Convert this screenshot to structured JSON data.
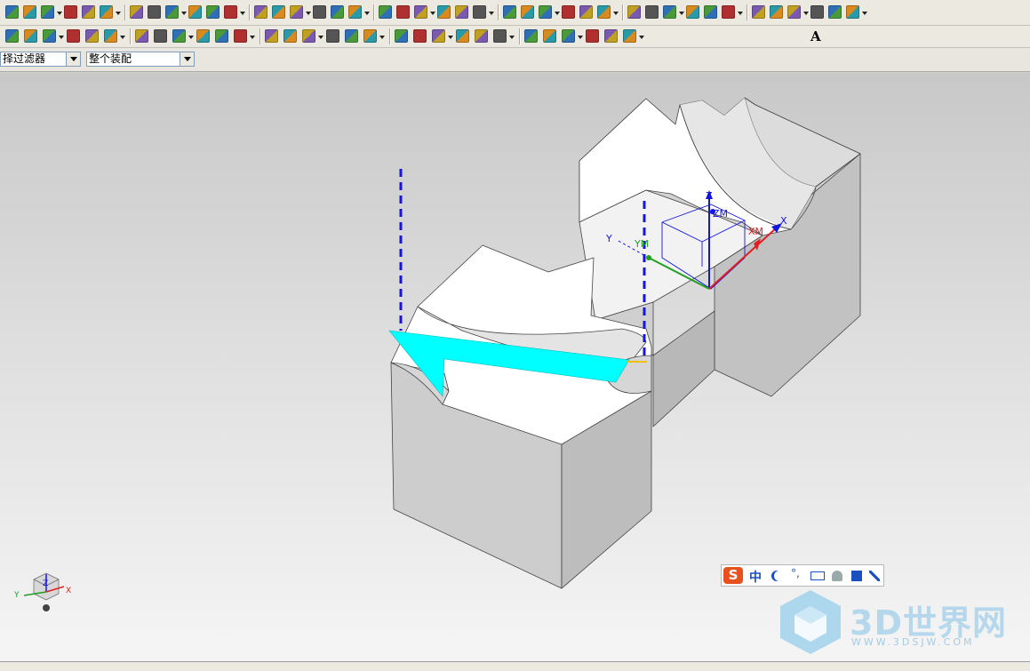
{
  "toolbar_row1": {
    "icons": [
      "open-part-icon",
      "save-icon",
      "save-as-icon",
      "print-icon",
      "assembly-icon",
      "add-component-icon",
      "mate-icon",
      "reposition-icon",
      "replace-icon",
      "suppress-icon",
      "wave-icon",
      "sketch-icon",
      "extrude-icon",
      "revolve-icon",
      "sweep-icon",
      "hole-icon",
      "boss-icon",
      "pocket-icon",
      "pad-icon",
      "slot-icon",
      "groove-icon",
      "edge-blend-icon",
      "chamfer-icon",
      "shell-selected-icon",
      "shell-all-icon",
      "point-icon",
      "spline-icon",
      "frame-icon",
      "datum-icon",
      "color-icon",
      "info-icon",
      "analysis-icon",
      "measure-icon",
      "section-icon",
      "thickness-icon",
      "curve-analysis-icon",
      "point-construct-icon",
      "delete-icon",
      "zoom-icon",
      "pan-icon",
      "rotate-icon",
      "fit-icon"
    ]
  },
  "toolbar_row2": {
    "icons": [
      "block-icon",
      "cylinder-icon",
      "cone-icon",
      "sphere-icon",
      "shade-icon",
      "wireframe-icon",
      "unite-icon",
      "subtract-icon",
      "intersect-icon",
      "trim-body-icon",
      "split-body-icon",
      "sew-icon",
      "check-icon",
      "layer-icon",
      "visibility-icon",
      "flag-icon",
      "copy-icon",
      "paste-icon",
      "view-front-icon",
      "view-top-icon",
      "view-right-icon",
      "view-iso-icon",
      "arrow-icon",
      "cursor-icon",
      "triangle-icon",
      "flag-small-icon",
      "line-icon",
      "arc-icon",
      "fillet-curve-icon",
      "text-icon"
    ],
    "text_label": "A"
  },
  "toolbar_row3": {
    "filter_value": "择过滤器",
    "assembly_scope_value": "整个装配"
  },
  "viewport": {
    "wcs_labels": {
      "x": "X",
      "y": "Y",
      "z": "Z"
    },
    "csys_labels": {
      "xm": "XM",
      "ym": "YM",
      "zm": "ZM"
    },
    "triad_labels": {
      "x": "X",
      "y": "Y",
      "z": "Z"
    },
    "colors": {
      "highlight_face": "#00ffff",
      "datum_blue": "#1515e0",
      "x_axis_red": "#e02020",
      "y_axis_green": "#20a020",
      "body_top": "#ffffff",
      "body_side": "#c6c6c6"
    }
  },
  "ime_bar": {
    "logo": "S",
    "mode": "中",
    "icons": [
      "moon-icon",
      "punctuation-icon",
      "keyboard-icon",
      "user-icon",
      "shirt-icon",
      "wrench-icon"
    ]
  },
  "watermark": {
    "brand": "3D世界网",
    "url": "WWW.3DSJW.COM"
  }
}
